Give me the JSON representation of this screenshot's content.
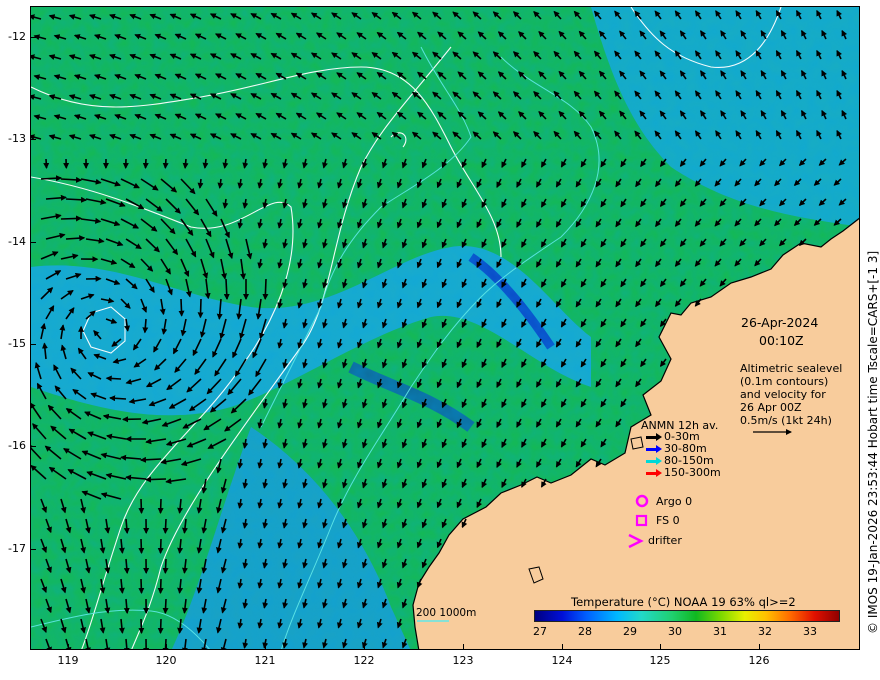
{
  "map": {
    "date": "26-Apr-2024",
    "time": "00:10Z",
    "note_lines": [
      "Altimetric sealevel",
      "(0.1m contours)",
      "and velocity for",
      "26 Apr 00Z",
      "0.5m/s (1kt 24h)"
    ],
    "x_ticks": [
      "119",
      "120",
      "121",
      "122",
      "123",
      "124",
      "125",
      "126"
    ],
    "y_ticks": [
      "-12",
      "-13",
      "-14",
      "-15",
      "-16",
      "-17"
    ],
    "side_text": "© IMOS 19-Jan-2026 23:53:44 Hobart time Tscale=CARS+[-1 3]",
    "scale_text": "200  1000m",
    "colors": {
      "land": "#f8cc9c",
      "sea_high": "#10c040",
      "sea_mid": "#18b0e0",
      "sea_low": "#0030d0",
      "contour_altimetry": "#ffffff",
      "contour_depth": "#60e8e8"
    }
  },
  "legend": {
    "title": "ANMN 12h av.",
    "items": [
      {
        "label": "0-30m",
        "color": "#000000"
      },
      {
        "label": "30-80m",
        "color": "#0000ff"
      },
      {
        "label": "80-150m",
        "color": "#00d8d8"
      },
      {
        "label": "150-300m",
        "color": "#ff0000"
      }
    ],
    "argo": "Argo 0",
    "fs": "FS 0",
    "drifter": "drifter",
    "marker_color": "#ff00ff"
  },
  "colorbar": {
    "title": "Temperature (°C) NOAA 19 63% ql>=2",
    "ticks": [
      "27",
      "28",
      "29",
      "30",
      "31",
      "32",
      "33"
    ]
  }
}
